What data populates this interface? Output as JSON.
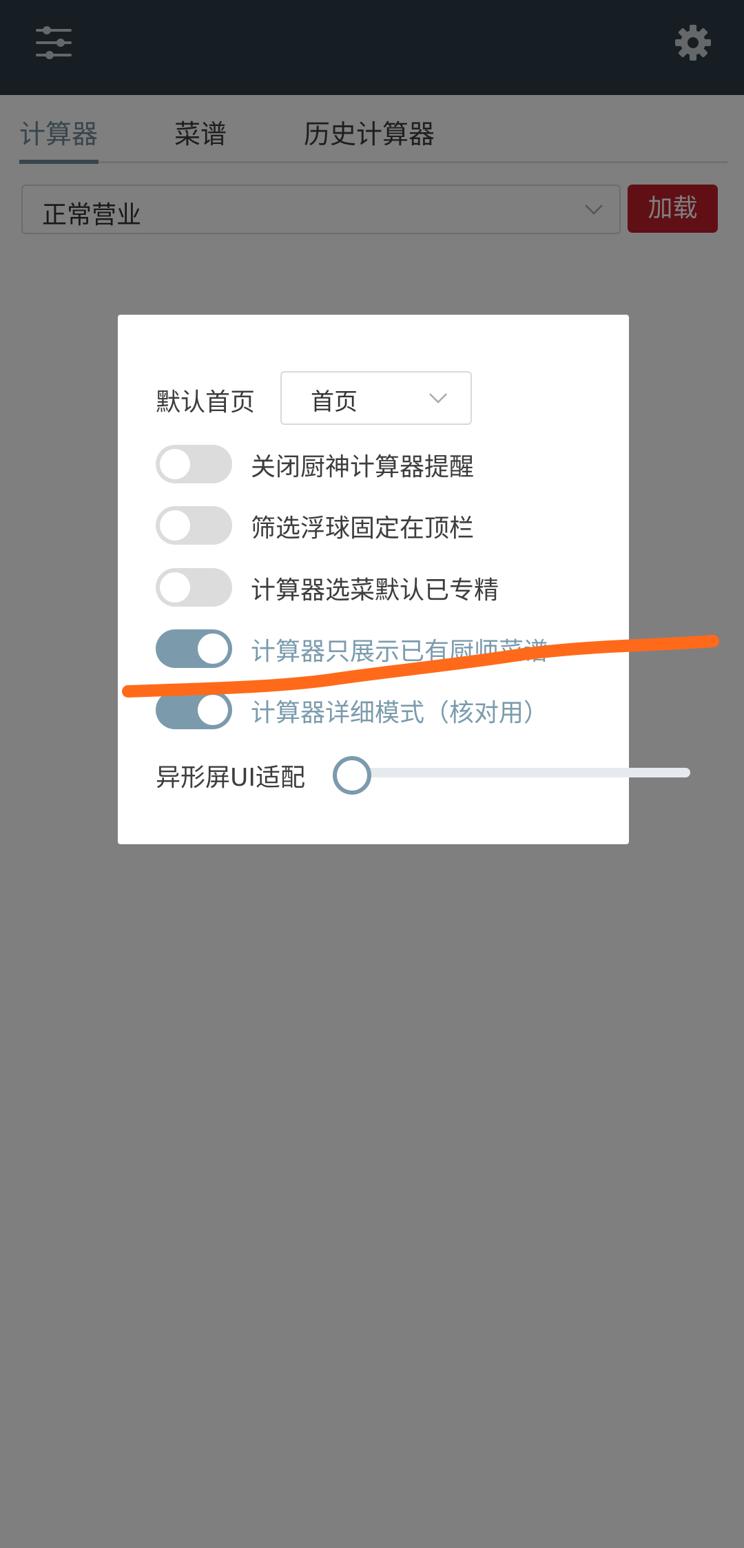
{
  "header": {
    "filter_icon": "sliders-icon",
    "settings_icon": "gear-icon"
  },
  "tabs": [
    {
      "label": "计算器",
      "active": true
    },
    {
      "label": "菜谱",
      "active": false
    },
    {
      "label": "历史计算器",
      "active": false
    }
  ],
  "mode_select": {
    "value": "正常营业"
  },
  "load_button": {
    "label": "加载"
  },
  "dialog": {
    "default_home": {
      "label": "默认首页",
      "value": "首页"
    },
    "switches": [
      {
        "label": "关闭厨神计算器提醒",
        "on": false
      },
      {
        "label": "筛选浮球固定在顶栏",
        "on": false
      },
      {
        "label": "计算器选菜默认已专精",
        "on": false
      },
      {
        "label": "计算器只展示已有厨师菜谱",
        "on": true
      },
      {
        "label": "计算器详细模式（核对用）",
        "on": true
      }
    ],
    "slider": {
      "label": "异形屏UI适配",
      "value": 0
    }
  },
  "colors": {
    "header_bg": "#2e3d47",
    "accent": "#7b9bad",
    "load_button": "#c0212a",
    "annotation_stroke": "#ff6a1a"
  }
}
